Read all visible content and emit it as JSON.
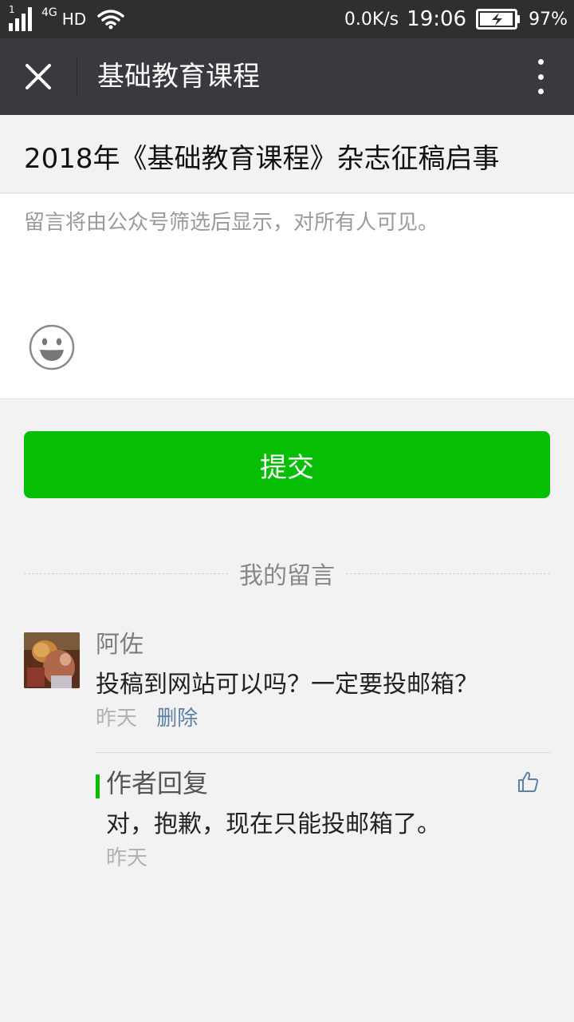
{
  "status_bar": {
    "sim_slot": "1",
    "network_type": "4G",
    "hd_label": "HD",
    "net_speed": "0.0K/s",
    "time": "19:06",
    "battery_percent": "97%",
    "battery_level": 0.97,
    "charging": true
  },
  "title_bar": {
    "title": "基础教育课程",
    "close_icon": "close-icon",
    "more_icon": "more-vertical-icon"
  },
  "article": {
    "title": "2018年《基础教育课程》杂志征稿启事"
  },
  "compose": {
    "placeholder": "留言将由公众号筛选后显示，对所有人可见。",
    "value": "",
    "emoji_icon": "smiley-icon"
  },
  "submit": {
    "label": "提交",
    "color": "#06be04"
  },
  "my_comments": {
    "section_label": "我的留言",
    "items": [
      {
        "nickname": "阿佐",
        "text": "投稿到网站可以吗？一定要投邮箱？",
        "time": "昨天",
        "delete_label": "删除",
        "reply": {
          "label": "作者回复",
          "text": "对，抱歉，现在只能投邮箱了。",
          "time": "昨天",
          "like_icon": "thumbs-up-icon"
        }
      }
    ]
  },
  "colors": {
    "status_bar_bg": "#2e2f31",
    "title_bar_bg": "#393a3f",
    "page_bg": "#f2f2f2",
    "link": "#607fa6",
    "accent_green": "#06be04"
  }
}
